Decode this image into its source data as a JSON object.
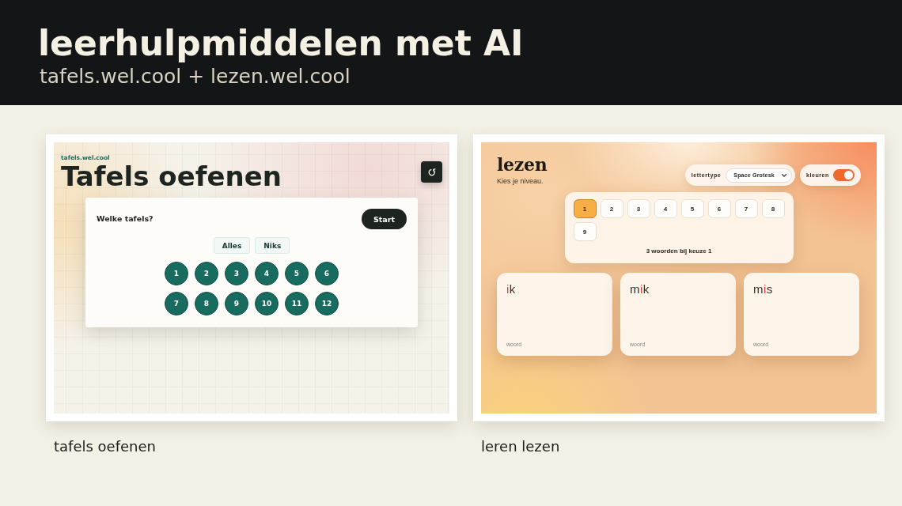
{
  "header": {
    "title": "leerhulpmiddelen met AI",
    "subtitle": "tafels.wel.cool + lezen.wel.cool"
  },
  "showcases": [
    {
      "kind": "tafels",
      "caption": "tafels oefenen",
      "app": {
        "site_label": "tafels.wel.cool",
        "title": "Tafels oefenen",
        "panel": {
          "heading": "Welke tafels?",
          "start_button": "Start",
          "quick_buttons": [
            "Alles",
            "Niks"
          ],
          "tables": [
            {
              "label": "1",
              "selected": true
            },
            {
              "label": "2",
              "selected": true
            },
            {
              "label": "3",
              "selected": true
            },
            {
              "label": "4",
              "selected": true
            },
            {
              "label": "5",
              "selected": true
            },
            {
              "label": "6",
              "selected": true
            },
            {
              "label": "7",
              "selected": true
            },
            {
              "label": "8",
              "selected": true
            },
            {
              "label": "9",
              "selected": true
            },
            {
              "label": "10",
              "selected": true
            },
            {
              "label": "11",
              "selected": true
            },
            {
              "label": "12",
              "selected": true
            }
          ]
        }
      }
    },
    {
      "kind": "lezen",
      "caption": "leren lezen",
      "app": {
        "title": "lezen",
        "subtitle": "Kies je niveau.",
        "font_setting": {
          "label": "lettertype",
          "value": "Space Grotesk"
        },
        "color_setting": {
          "label": "kleuren",
          "on": true
        },
        "levels": [
          {
            "label": "1",
            "selected": true
          },
          {
            "label": "2",
            "selected": false
          },
          {
            "label": "3",
            "selected": false
          },
          {
            "label": "4",
            "selected": false
          },
          {
            "label": "5",
            "selected": false
          },
          {
            "label": "6",
            "selected": false
          },
          {
            "label": "7",
            "selected": false
          },
          {
            "label": "8",
            "selected": false
          },
          {
            "label": "9",
            "selected": false
          }
        ],
        "summary": "3 woorden bij keuze 1",
        "words": [
          {
            "letters": [
              {
                "text": "i",
                "highlighted": true
              },
              {
                "text": "k",
                "highlighted": false
              }
            ],
            "label": "woord"
          },
          {
            "letters": [
              {
                "text": "m",
                "highlighted": false
              },
              {
                "text": "i",
                "highlighted": true
              },
              {
                "text": "k",
                "highlighted": false
              }
            ],
            "label": "woord"
          },
          {
            "letters": [
              {
                "text": "m",
                "highlighted": false
              },
              {
                "text": "i",
                "highlighted": true
              },
              {
                "text": "s",
                "highlighted": false
              }
            ],
            "label": "woord"
          }
        ]
      }
    }
  ]
}
